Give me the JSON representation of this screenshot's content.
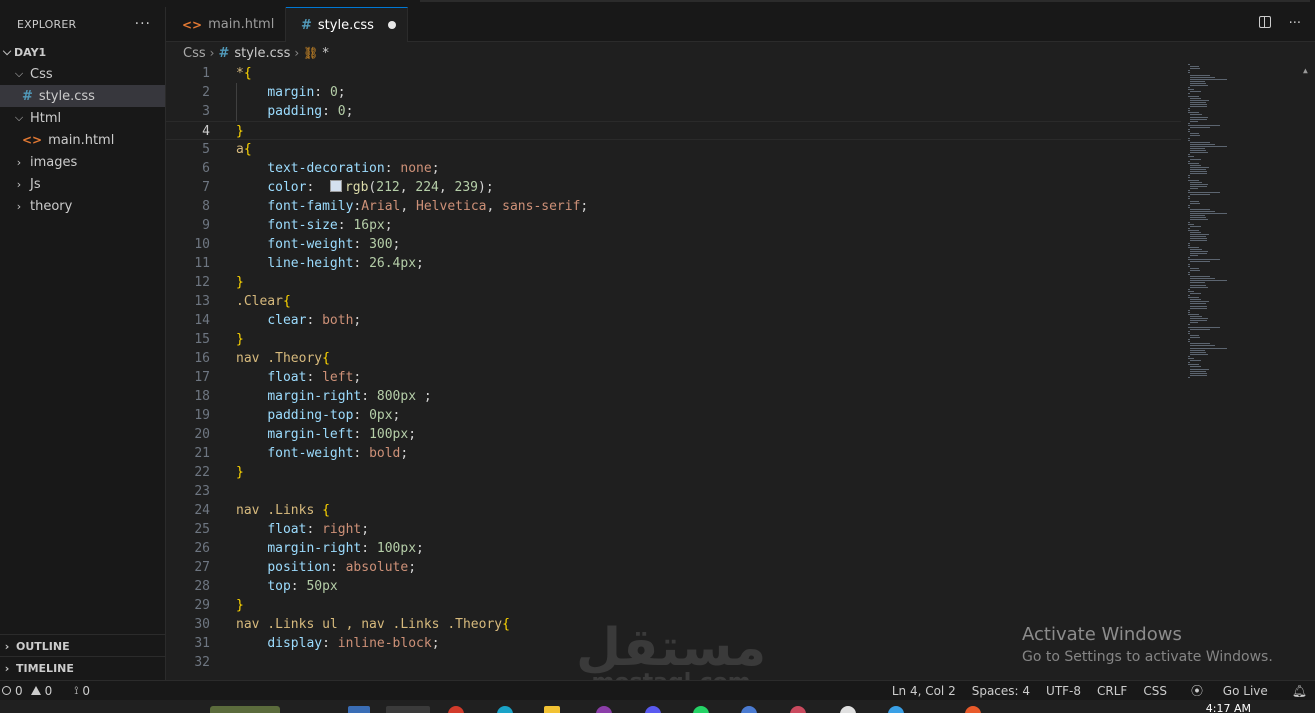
{
  "sidebar": {
    "title": "EXPLORER",
    "more": "···",
    "root": "DAY1",
    "items": [
      {
        "label": "Css",
        "type": "folder",
        "open": true
      },
      {
        "label": "style.css",
        "type": "css"
      },
      {
        "label": "Html",
        "type": "folder",
        "open": true
      },
      {
        "label": "main.html",
        "type": "html"
      },
      {
        "label": "images",
        "type": "folder",
        "open": false
      },
      {
        "label": "Js",
        "type": "folder",
        "open": false
      },
      {
        "label": "theory",
        "type": "folder",
        "open": false
      }
    ],
    "outline": "OUTLINE",
    "timeline": "TIMELINE"
  },
  "tabs": [
    {
      "label": "main.html",
      "active": false
    },
    {
      "label": "style.css",
      "active": true,
      "modified": true
    }
  ],
  "breadcrumb": {
    "folder": "Css",
    "file": "style.css",
    "symbol": "*"
  },
  "editor": {
    "lines": [
      "*{",
      "    margin: 0;",
      "    padding: 0;",
      "}",
      "a{",
      "    text-decoration: none;",
      "    color:  rgb(212, 224, 239);",
      "    font-family:Arial, Helvetica, sans-serif;",
      "    font-size: 16px;",
      "    font-weight: 300;",
      "    line-height: 26.4px;",
      "}",
      ".Clear{",
      "    clear: both;",
      "}",
      "nav .Theory{",
      "    float: left;",
      "    margin-right: 800px ;",
      "    padding-top: 0px;",
      "    margin-left: 100px;",
      "    font-weight: bold;",
      "}",
      "",
      "nav .Links {",
      "    float: right;",
      "    margin-right: 100px;",
      "    position: absolute;",
      "    top: 50px",
      "}",
      "nav .Links ul , nav .Links .Theory{",
      "    display: inline-block;",
      ""
    ],
    "current_line": 4
  },
  "watermark": {
    "title": "Activate Windows",
    "subtitle": "Go to Settings to activate Windows."
  },
  "logo": {
    "arabic": "مستقل",
    "latin": "mostaql.com"
  },
  "status": {
    "errors": "0",
    "warnings": "0",
    "ports": "0",
    "position": "Ln 4, Col 2",
    "spaces": "Spaces: 4",
    "encoding": "UTF-8",
    "eol": "CRLF",
    "language": "CSS",
    "golive": "Go Live"
  },
  "taskbar": {
    "time": "4:17 AM"
  },
  "colors": {
    "accent": "#0078d4",
    "swatch": "#d4e0ef"
  }
}
